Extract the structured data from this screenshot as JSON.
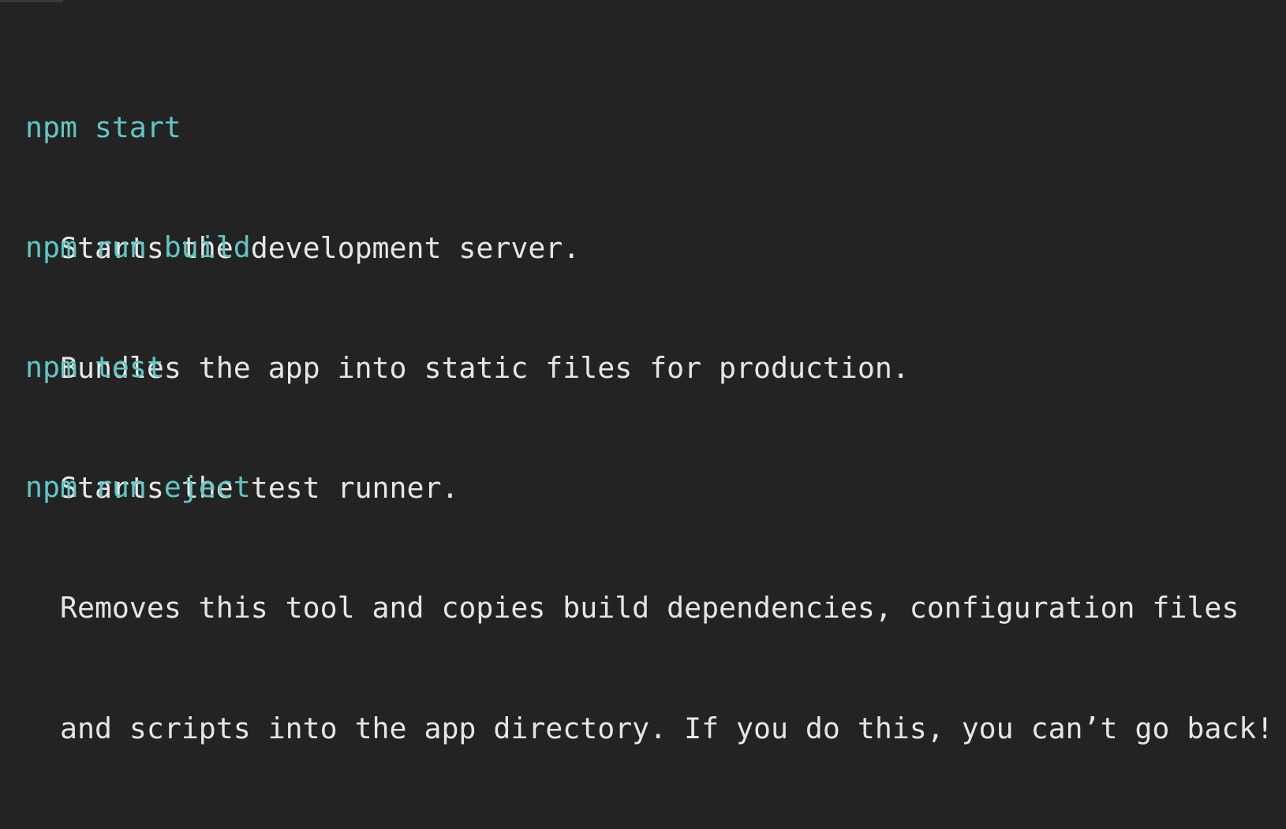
{
  "commands": [
    {
      "command": "npm start",
      "description": [
        "Starts the development server."
      ]
    },
    {
      "command": "npm run build",
      "description": [
        "Bundles the app into static files for production."
      ]
    },
    {
      "command": "npm test",
      "description": [
        "Starts the test runner."
      ]
    },
    {
      "command": "npm run eject",
      "description": [
        "Removes this tool and copies build dependencies, configuration files",
        "and scripts into the app directory. If you do this, you can’t go back!"
      ]
    }
  ],
  "colors": {
    "background": "#232323",
    "command": "#5fc7c4",
    "description": "#e6e6e6"
  }
}
